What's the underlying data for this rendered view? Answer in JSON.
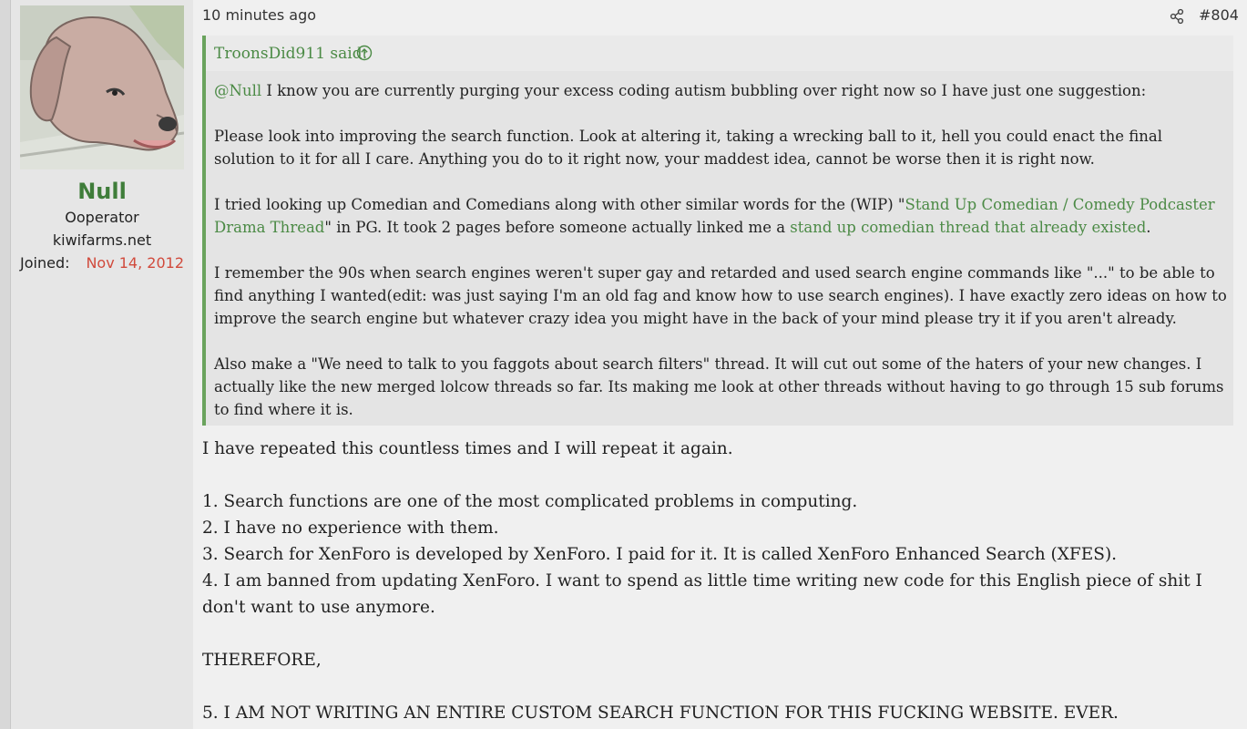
{
  "user": {
    "name": "Null",
    "title": "Ooperator",
    "banner": "kiwifarms.net",
    "joined_label": "Joined:",
    "joined_value": "Nov 14, 2012",
    "avatar_icon": "dog-avatar-icon"
  },
  "post": {
    "time": "10 minutes ago",
    "number": "#804",
    "share_icon": "share-icon"
  },
  "quote": {
    "author": "TroonsDid911 said:",
    "up_icon": "arrow-up-circle-icon",
    "p1_mention": "@Null",
    "p1_text": " I know you are currently purging your excess coding autism bubbling over right now so I have just one suggestion:",
    "p2": "Please look into improving the search function. Look at altering it, taking a wrecking ball to it, hell you could enact the final solution to it for all I care. Anything you do to it right now, your maddest idea, cannot be worse then it is right now.",
    "p3_a": "I tried looking up Comedian and Comedians along with other similar words for the (WIP) \"",
    "p3_link1": "Stand Up Comedian / Comedy Podcaster Drama Thread",
    "p3_b": "\" in PG. It took 2 pages before someone actually linked me a ",
    "p3_link2": "stand up comedian thread that already existed",
    "p3_c": ".",
    "p4": "I remember the 90s when search engines weren't super gay and retarded and used search engine commands like \"...\" to be able to find anything I wanted(edit: was just saying I'm an old fag and know how to use search engines). I have exactly zero ideas on how to improve the search engine but whatever crazy idea you might have in the back of your mind please try it if you aren't already.",
    "p5": "Also make a \"We need to talk to you faggots about search filters\" thread. It will cut out some of the haters of your new changes. I actually like the new merged lolcow threads so far. Its making me look at other threads without having to go through 15 sub forums to find where it is."
  },
  "body": {
    "intro": "I have repeated this countless times and I will repeat it again.",
    "item1": "1. Search functions are one of the most complicated problems in computing.",
    "item2": "2. I have no experience with them.",
    "item3": "3. Search for XenForo is developed by XenForo. I paid for it. It is called XenForo Enhanced Search (XFES).",
    "item4": "4. I am banned from updating XenForo. I want to spend as little time writing new code for this English piece of shit I don't want to use anymore.",
    "therefore": "THEREFORE,",
    "item5": "5. I AM NOT WRITING AN ENTIRE CUSTOM SEARCH FUNCTION FOR THIS FUCKING WEBSITE. EVER."
  },
  "colors": {
    "accent_green": "#4b8a45",
    "username_green": "#3f7d3a",
    "joined_red": "#d14a3c",
    "quote_border": "#6aa35d"
  }
}
